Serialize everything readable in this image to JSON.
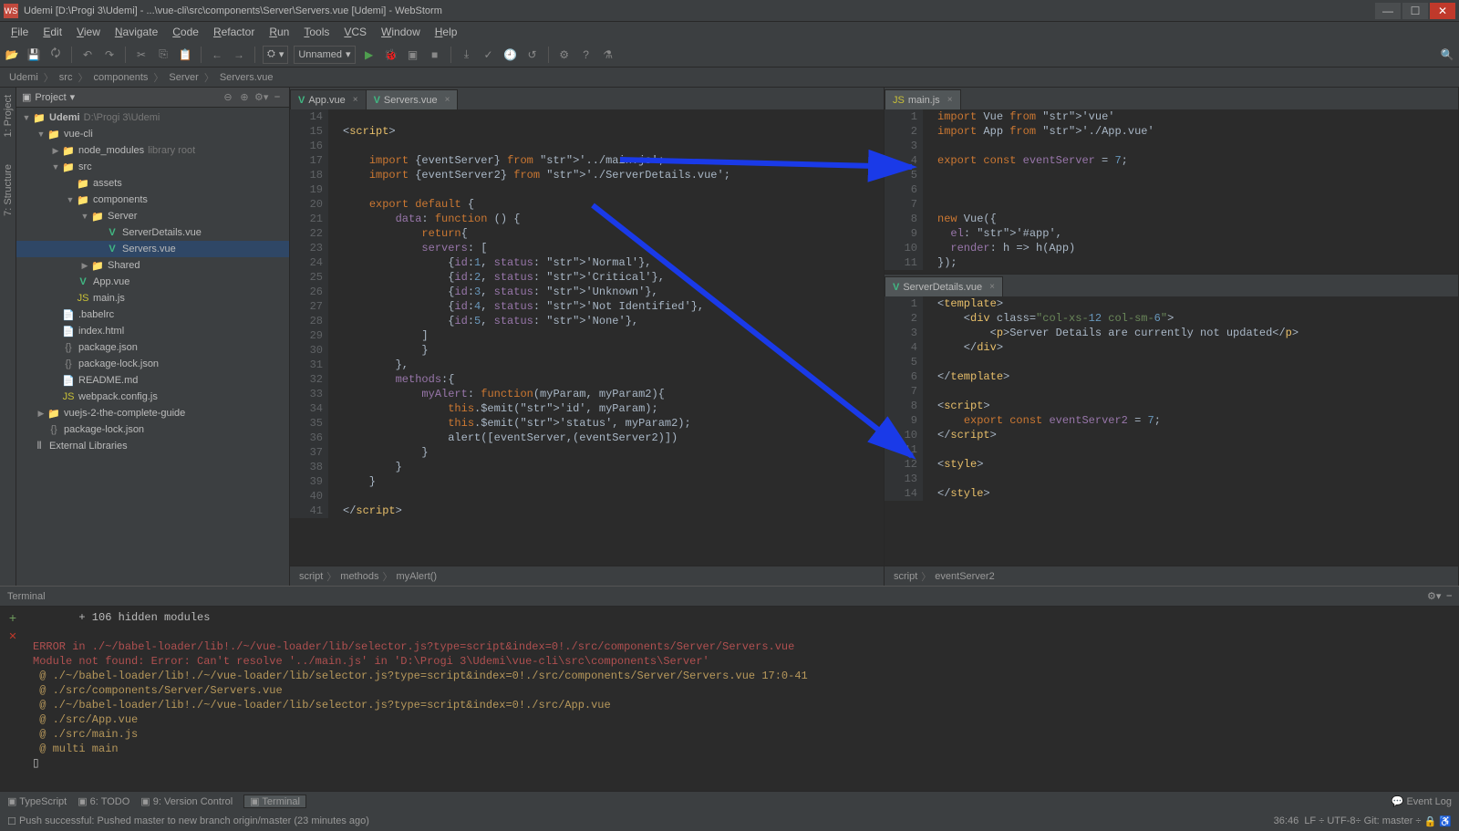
{
  "window": {
    "title": "Udemi [D:\\Progi 3\\Udemi] - ...\\vue-cli\\src\\components\\Server\\Servers.vue [Udemi] - WebStorm",
    "app_icon_label": "WS"
  },
  "menu": [
    "File",
    "Edit",
    "View",
    "Navigate",
    "Code",
    "Refactor",
    "Run",
    "Tools",
    "VCS",
    "Window",
    "Help"
  ],
  "run_config": "Unnamed",
  "breadcrumb": [
    "Udemi",
    "src",
    "components",
    "Server",
    "Servers.vue"
  ],
  "sidebar_tabs": [
    "1: Project",
    "7: Structure"
  ],
  "project_header": "Project",
  "tree": {
    "root": {
      "name": "Udemi",
      "path": "D:\\Progi 3\\Udemi"
    },
    "items": [
      {
        "indent": 1,
        "arrow": "▼",
        "icon": "folder",
        "name": "vue-cli"
      },
      {
        "indent": 2,
        "arrow": "▶",
        "icon": "folder",
        "name": "node_modules",
        "dim": "library root"
      },
      {
        "indent": 2,
        "arrow": "▼",
        "icon": "folder",
        "name": "src"
      },
      {
        "indent": 3,
        "arrow": "",
        "icon": "folder",
        "name": "assets"
      },
      {
        "indent": 3,
        "arrow": "▼",
        "icon": "folder",
        "name": "components"
      },
      {
        "indent": 4,
        "arrow": "▼",
        "icon": "folder",
        "name": "Server"
      },
      {
        "indent": 5,
        "arrow": "",
        "icon": "vue",
        "name": "ServerDetails.vue"
      },
      {
        "indent": 5,
        "arrow": "",
        "icon": "vue",
        "name": "Servers.vue",
        "selected": true
      },
      {
        "indent": 4,
        "arrow": "▶",
        "icon": "folder",
        "name": "Shared"
      },
      {
        "indent": 3,
        "arrow": "",
        "icon": "vue",
        "name": "App.vue"
      },
      {
        "indent": 3,
        "arrow": "",
        "icon": "js",
        "name": "main.js"
      },
      {
        "indent": 2,
        "arrow": "",
        "icon": "file",
        "name": ".babelrc"
      },
      {
        "indent": 2,
        "arrow": "",
        "icon": "file",
        "name": "index.html"
      },
      {
        "indent": 2,
        "arrow": "",
        "icon": "json",
        "name": "package.json"
      },
      {
        "indent": 2,
        "arrow": "",
        "icon": "json",
        "name": "package-lock.json"
      },
      {
        "indent": 2,
        "arrow": "",
        "icon": "file",
        "name": "README.md"
      },
      {
        "indent": 2,
        "arrow": "",
        "icon": "js",
        "name": "webpack.config.js"
      },
      {
        "indent": 1,
        "arrow": "▶",
        "icon": "folder",
        "name": "vuejs-2-the-complete-guide"
      },
      {
        "indent": 1,
        "arrow": "",
        "icon": "json",
        "name": "package-lock.json"
      },
      {
        "indent": 0,
        "arrow": "",
        "icon": "lib",
        "name": "External Libraries"
      }
    ]
  },
  "editor_left": {
    "tabs": [
      {
        "icon": "vue",
        "name": "App.vue",
        "active": false
      },
      {
        "icon": "vue",
        "name": "Servers.vue",
        "active": true
      }
    ],
    "first_line": 14,
    "lines": [
      "",
      "<script>",
      "",
      "    import {eventServer} from '../main.js';",
      "    import {eventServer2} from './ServerDetails.vue';",
      "",
      "    export default {",
      "        data: function () {",
      "            return{",
      "            servers: [",
      "                {id:1, status: 'Normal'},",
      "                {id:2, status: 'Critical'},",
      "                {id:3, status: 'Unknown'},",
      "                {id:4, status: 'Not Identified'},",
      "                {id:5, status: 'None'},",
      "            ]",
      "            }",
      "        },",
      "        methods:{",
      "            myAlert: function(myParam, myParam2){",
      "                this.$emit('id', myParam);",
      "                this.$emit('status', myParam2);",
      "                alert([eventServer,(eventServer2)])",
      "            }",
      "        }",
      "    }",
      "",
      "</script>"
    ],
    "breadcrumb": [
      "script",
      "methods",
      "myAlert()"
    ]
  },
  "editor_right_top": {
    "tabs": [
      {
        "icon": "js",
        "name": "main.js",
        "active": true
      }
    ],
    "first_line": 1,
    "lines": [
      "import Vue from 'vue'",
      "import App from './App.vue'",
      "",
      "export const eventServer = 7;",
      "",
      "",
      "",
      "new Vue({",
      "  el: '#app',",
      "  render: h => h(App)",
      "});"
    ]
  },
  "editor_right_bottom": {
    "tabs": [
      {
        "icon": "vue",
        "name": "ServerDetails.vue",
        "active": true
      }
    ],
    "first_line": 1,
    "lines": [
      "<template>",
      "    <div class=\"col-xs-12 col-sm-6\">",
      "        <p>Server Details are currently not updated</p>",
      "    </div>",
      "",
      "</template>",
      "",
      "<script>",
      "    export const eventServer2 = 7;",
      "</script>",
      "",
      "<style>",
      "",
      "</style>"
    ],
    "breadcrumb": [
      "script",
      "eventServer2"
    ]
  },
  "terminal": {
    "title": "Terminal",
    "lines": [
      {
        "cls": "",
        "text": "       + 106 hidden modules"
      },
      {
        "cls": "",
        "text": ""
      },
      {
        "cls": "err",
        "text": "ERROR in ./~/babel-loader/lib!./~/vue-loader/lib/selector.js?type=script&index=0!./src/components/Server/Servers.vue"
      },
      {
        "cls": "err",
        "text": "Module not found: Error: Can't resolve '../main.js' in 'D:\\Progi 3\\Udemi\\vue-cli\\src\\components\\Server'"
      },
      {
        "cls": "wrn",
        "text": " @ ./~/babel-loader/lib!./~/vue-loader/lib/selector.js?type=script&index=0!./src/components/Server/Servers.vue 17:0-41"
      },
      {
        "cls": "wrn",
        "text": " @ ./src/components/Server/Servers.vue"
      },
      {
        "cls": "wrn",
        "text": " @ ./~/babel-loader/lib!./~/vue-loader/lib/selector.js?type=script&index=0!./src/App.vue"
      },
      {
        "cls": "wrn",
        "text": " @ ./src/App.vue"
      },
      {
        "cls": "wrn",
        "text": " @ ./src/main.js"
      },
      {
        "cls": "wrn",
        "text": " @ multi main"
      },
      {
        "cls": "",
        "text": "▯"
      }
    ]
  },
  "bottom_tools": [
    "TypeScript",
    "6: TODO",
    "9: Version Control",
    "Terminal"
  ],
  "bottom_tools_active": "Terminal",
  "event_log": "Event Log",
  "status": {
    "msg": "Push successful: Pushed master to new branch origin/master (23 minutes ago)",
    "pos": "36:46",
    "lf": "LF",
    "enc": "UTF-8",
    "git": "Git: master"
  }
}
